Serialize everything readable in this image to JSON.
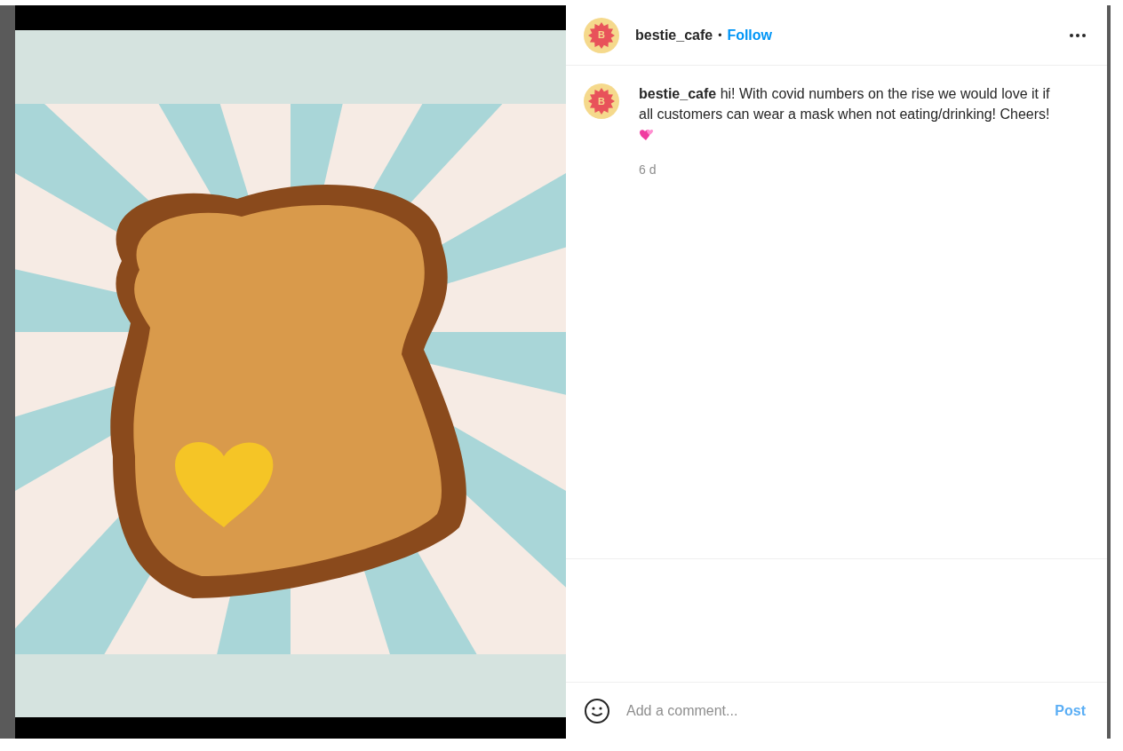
{
  "header": {
    "username": "bestie_cafe",
    "separator": "•",
    "follow": "Follow",
    "avatar_letter": "B"
  },
  "caption": {
    "username": "bestie_cafe",
    "text": "hi! With covid numbers on the rise we would love it if all customers can wear a mask when not eating/drinking! Cheers!",
    "avatar_letter": "B",
    "time": "6 d"
  },
  "comment_box": {
    "placeholder": "Add a comment...",
    "post": "Post",
    "disabled": true
  }
}
